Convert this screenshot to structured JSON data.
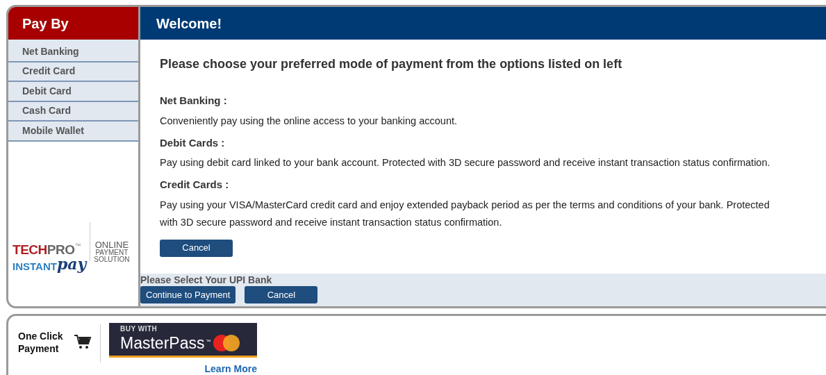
{
  "sidebar": {
    "title": "Pay By",
    "items": [
      {
        "label": "Net Banking"
      },
      {
        "label": "Credit Card"
      },
      {
        "label": "Debit Card"
      },
      {
        "label": "Cash Card"
      },
      {
        "label": "Mobile Wallet"
      }
    ],
    "logo": {
      "brand_red": "TECH",
      "brand_gray": "PRO",
      "trademark": "™",
      "sub_brand": "INSTANT",
      "script": "pay",
      "tagline": [
        "ONLINE",
        "PAYMENT",
        "SOLUTION"
      ]
    }
  },
  "main": {
    "title": "Welcome!",
    "heading": "Please choose your preferred mode of payment from the options listed on left",
    "sections": [
      {
        "title": "Net Banking :",
        "text": "Conveniently pay using the online access to your banking account."
      },
      {
        "title": "Debit Cards :",
        "text": "Pay using debit card linked to your bank account. Protected with 3D secure password and receive instant transaction status confirmation."
      },
      {
        "title": "Credit Cards :",
        "text": "Pay using your VISA/MasterCard credit card and enjoy extended payback period as per the terms and conditions of your bank. Protected with 3D secure password and receive instant transaction status confirmation."
      }
    ],
    "cancel_button": "Cancel",
    "upi": {
      "label": "Please Select Your UPI Bank",
      "buttons": [
        "Continue to Payment",
        "Cancel"
      ]
    }
  },
  "footer": {
    "one_click": "One Click Payment",
    "badge": {
      "top": "BUY WITH",
      "name": "MasterPass",
      "tm": "™"
    },
    "link": "Learn More"
  }
}
